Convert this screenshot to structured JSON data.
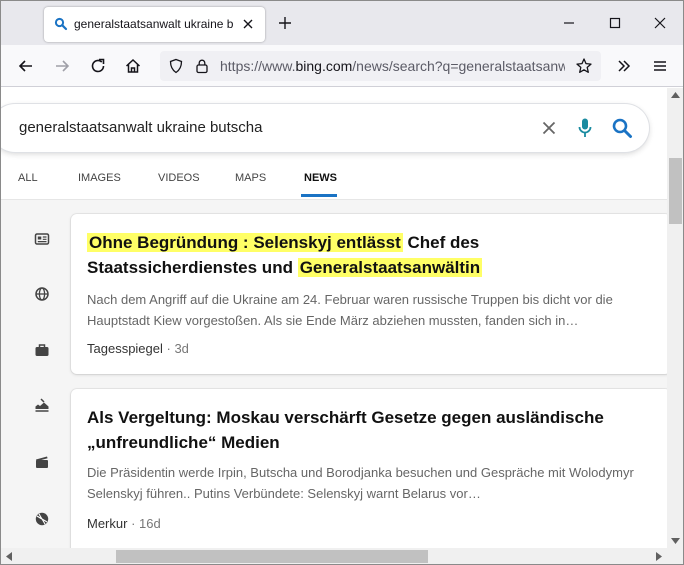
{
  "browser": {
    "tab_title": "generalstaatsanwalt ukraine butscha - Suche",
    "url_prefix": "https://www.",
    "url_domain": "bing.com",
    "url_path": "/news/search?q=generalstaatsanwalt+ukraine+butscha"
  },
  "search": {
    "query": "generalstaatsanwalt ukraine butscha"
  },
  "tabs": [
    {
      "label": "ALL"
    },
    {
      "label": "IMAGES"
    },
    {
      "label": "VIDEOS"
    },
    {
      "label": "MAPS"
    },
    {
      "label": "NEWS"
    }
  ],
  "side_icons": [
    "news-icon",
    "globe-icon",
    "briefcase-icon",
    "science-icon",
    "clapperboard-icon",
    "sports-ball-icon"
  ],
  "results": [
    {
      "title_hl1": "Ohne Begründung : Selenskyj entlässt",
      "title_mid": " Chef des Staatssicherdienstes und ",
      "title_hl2": "Generalstaatsanwältin",
      "snippet": "Nach dem Angriff auf die Ukraine am 24. Februar waren russische Truppen bis dicht vor die Hauptstadt Kiew vorgestoßen. Als sie Ende März abziehen mussten, fanden sich in…",
      "source": "Tagesspiegel",
      "sep": " · ",
      "age": "3d"
    },
    {
      "title": "Als Vergeltung: Moskau verschärft Gesetze gegen ausländische „unfreundliche“ Medien",
      "snippet": "Die Präsidentin werde Irpin, Butscha und Borodjanka besuchen und Gespräche mit Wolodymyr Selenskyj führen.. Putins Verbündete: Selenskyj warnt Belarus vor…",
      "source": "Merkur",
      "sep": " · ",
      "age": "16d"
    }
  ],
  "colors": {
    "accent": "#1a73c4",
    "highlight": "#ffff66",
    "mic": "#1a8ba0"
  }
}
